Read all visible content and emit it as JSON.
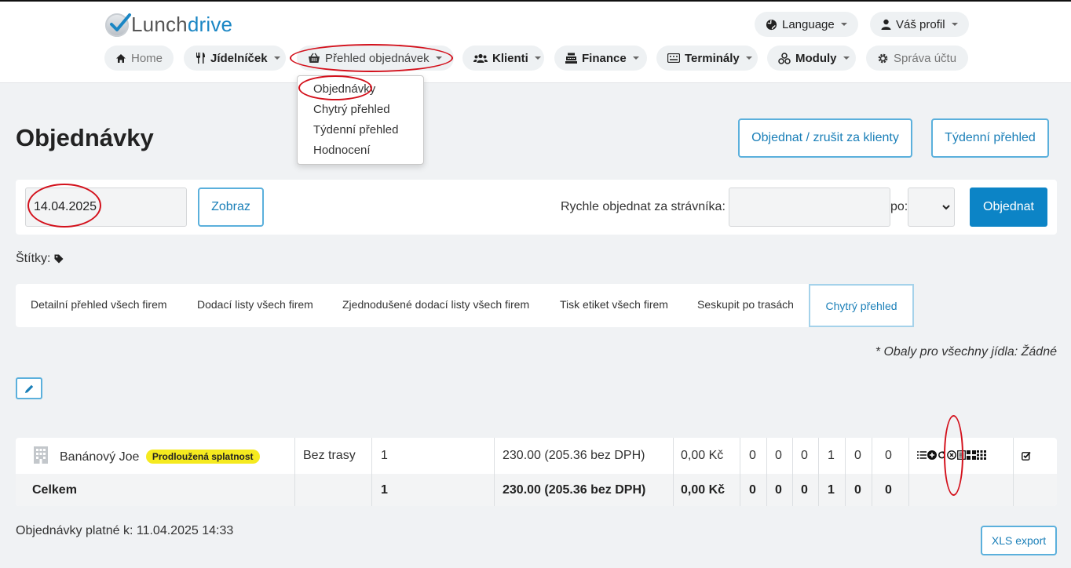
{
  "header": {
    "logo": {
      "part1": "Lunch",
      "part2": "drive"
    },
    "language_label": "Language",
    "profile_label": "Váš profil",
    "nav": [
      {
        "label": "Home"
      },
      {
        "label": "Jídelníček"
      },
      {
        "label": "Přehled objednávek"
      },
      {
        "label": "Klienti"
      },
      {
        "label": "Finance"
      },
      {
        "label": "Terminály"
      },
      {
        "label": "Moduly"
      },
      {
        "label": "Správa účtu"
      }
    ]
  },
  "dropdown": {
    "items": [
      "Objednávky",
      "Chytrý přehled",
      "Týdenní přehled",
      "Hodnocení"
    ]
  },
  "page": {
    "title": "Objednávky",
    "btn_order_cancel": "Objednat / zrušit za klienty",
    "btn_weekly": "Týdenní přehled"
  },
  "filter": {
    "date_value": "14.04.2025",
    "show_button": "Zobraz",
    "quick_order_label": "Rychle objednat za strávníka:",
    "quick_order_value": "",
    "po_label": "po:",
    "po_value": "",
    "order_button": "Objednat"
  },
  "tags_label": "Štítky:",
  "tabs": [
    "Detailní přehled všech firem",
    "Dodací listy všech firem",
    "Zjednodušené dodací listy všech firem",
    "Tisk etiket všech firem",
    "Seskupit po trasách",
    "Chytrý přehled"
  ],
  "packaging_note": "* Obaly pro všechny jídla: Žádné",
  "table": {
    "rows": [
      {
        "name": "Banánový Joe",
        "badge": "Prodloužená splatnost",
        "route": "Bez trasy",
        "count": "1",
        "price": "230.00 (205.36 bez DPH)",
        "amount": "0,00 Kč",
        "c1": "0",
        "c2": "0",
        "c3": "0",
        "c4": "1",
        "c5": "0",
        "c6": "0"
      }
    ],
    "total": {
      "label": "Celkem",
      "route": "",
      "count": "1",
      "price": "230.00 (205.36 bez DPH)",
      "amount": "0,00 Kč",
      "c1": "0",
      "c2": "0",
      "c3": "0",
      "c4": "1",
      "c5": "0",
      "c6": "0"
    }
  },
  "footer": {
    "valid_text": "Objednávky platné k: 11.04.2025 14:33",
    "xls_button": "XLS export"
  },
  "colors": {
    "accent": "#0c84c6",
    "badge": "#f5ea1f",
    "annotation": "#d3111c"
  }
}
